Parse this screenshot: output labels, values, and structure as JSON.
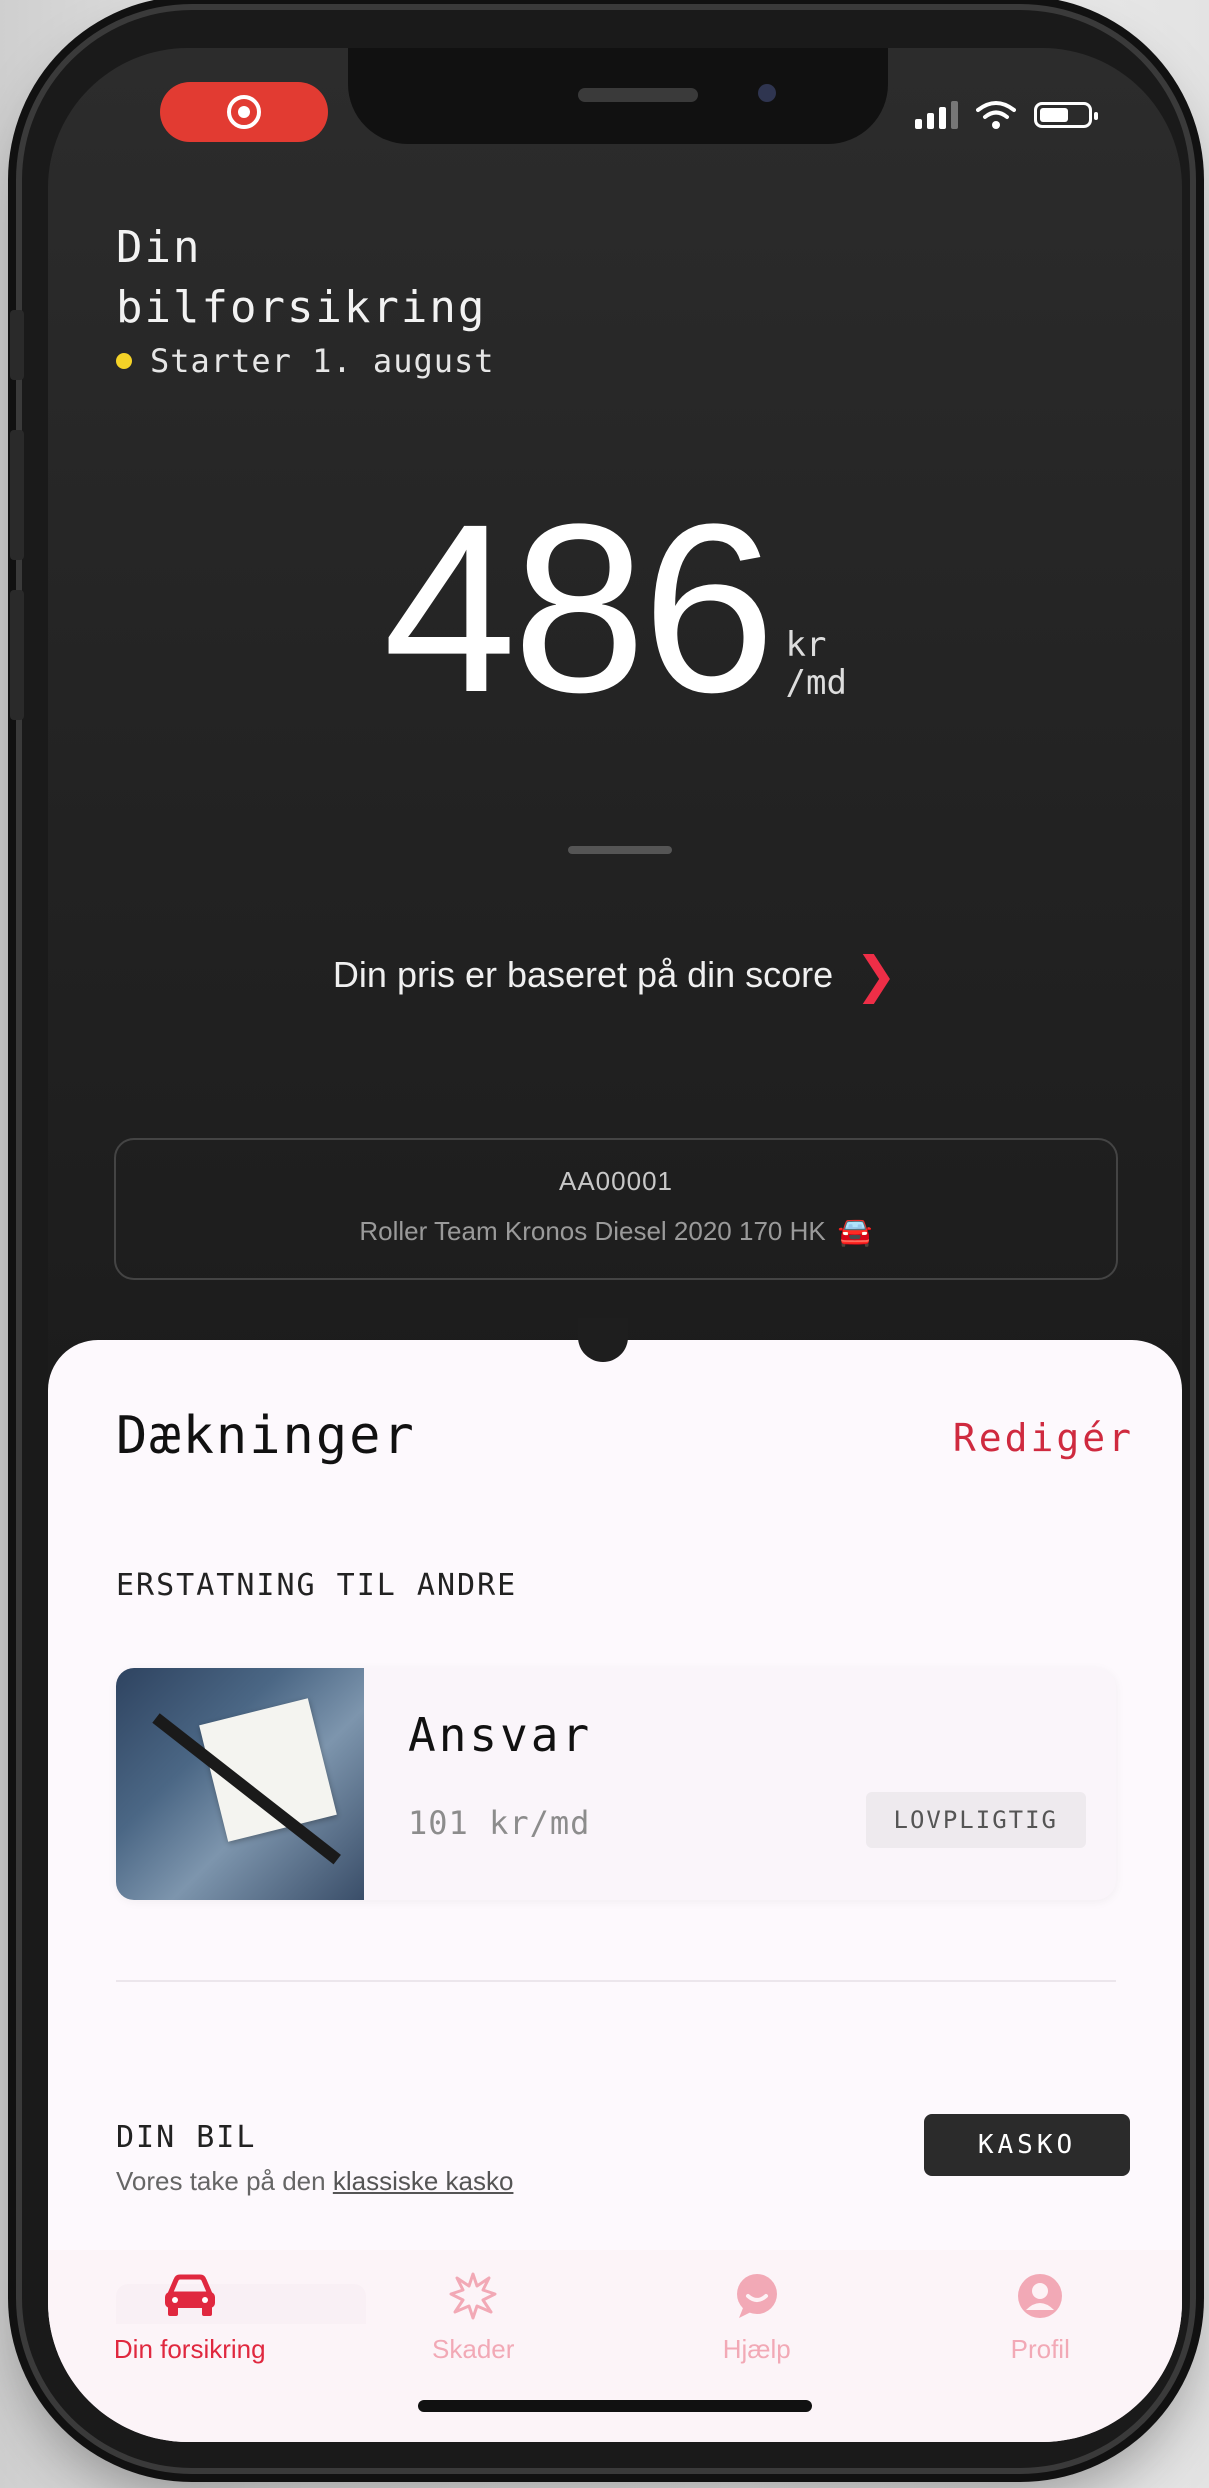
{
  "status_bar": {
    "icons": [
      "record-icon",
      "signal-icon",
      "wifi-icon",
      "battery-icon"
    ]
  },
  "header": {
    "title_line1": "Din",
    "title_line2": "bilforsikring",
    "start_status": "Starter 1. august",
    "start_dot_color": "#f5d327"
  },
  "price": {
    "amount": "486",
    "unit_line1": "kr",
    "unit_line2": "/md"
  },
  "score_link": {
    "label": "Din pris er baseret på din score"
  },
  "car": {
    "plate": "AA00001",
    "description": "Roller Team  Kronos  Diesel  2020  170 HK",
    "emoji": "🚘"
  },
  "coverage": {
    "title": "Dækninger",
    "edit_label": "Redigér",
    "section1_label": "ERSTATNING TIL ANDRE",
    "items": [
      {
        "name": "Ansvar",
        "price": "101 kr/md",
        "badge": "LOVPLIGTIG"
      }
    ],
    "section2_label": "DIN BIL",
    "section2_sub_prefix": "Vores take på den ",
    "section2_sub_link": "klassiske kasko",
    "section2_badge": "KASKO"
  },
  "tabbar": {
    "tabs": [
      {
        "label": "Din forsikring",
        "icon": "car-icon",
        "active": true
      },
      {
        "label": "Skader",
        "icon": "crash-icon",
        "active": false
      },
      {
        "label": "Hjælp",
        "icon": "chat-icon",
        "active": false
      },
      {
        "label": "Profil",
        "icon": "user-icon",
        "active": false
      }
    ]
  },
  "colors": {
    "accent": "#e0283f",
    "dark_bg": "#1b1b1b",
    "sheet_bg": "#fdf9fd"
  }
}
